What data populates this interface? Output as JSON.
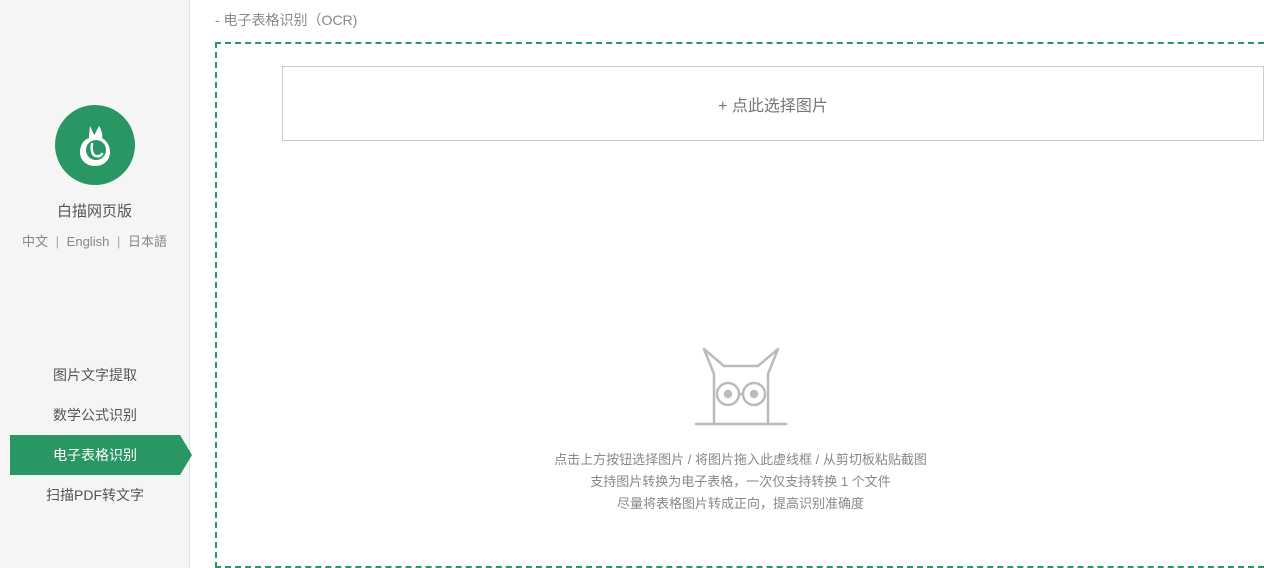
{
  "sidebar": {
    "app_title": "白描网页版",
    "languages": {
      "zh": "中文",
      "en": "English",
      "ja": "日本語"
    },
    "nav": [
      {
        "label": "图片文字提取",
        "active": false
      },
      {
        "label": "数学公式识别",
        "active": false
      },
      {
        "label": "电子表格识别",
        "active": true
      },
      {
        "label": "扫描PDF转文字",
        "active": false
      }
    ]
  },
  "main": {
    "breadcrumb": "- 电子表格识别（OCR)",
    "select_button": "+ 点此选择图片",
    "hints": [
      "点击上方按钮选择图片 / 将图片拖入此虚线框 / 从剪切板粘贴截图",
      "支持图片转换为电子表格，一次仅支持转换 1 个文件",
      "尽量将表格图片转成正向，提高识别准确度"
    ]
  },
  "colors": {
    "accent": "#299764"
  }
}
